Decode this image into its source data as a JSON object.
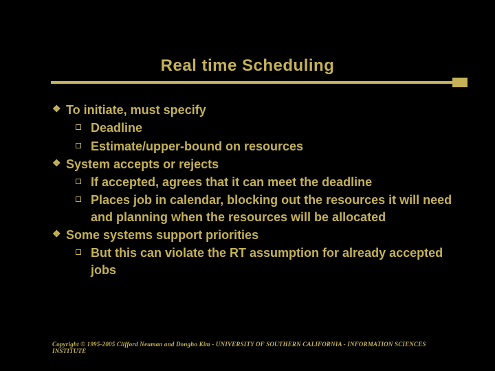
{
  "title": "Real time Scheduling",
  "bullets": {
    "b1": "To initiate, must specify",
    "b1a": "Deadline",
    "b1b": "Estimate/upper-bound on resources",
    "b2": "System accepts or rejects",
    "b2a": "If accepted, agrees that it can meet the deadline",
    "b2b": "Places job in calendar, blocking out the resources it will need and planning when the resources will be allocated",
    "b3": "Some systems support priorities",
    "b3a": "But this can violate the RT assumption for already accepted jobs"
  },
  "footer": "Copyright © 1995-2005 Clifford Neuman and Dongho Kim - UNIVERSITY OF SOUTHERN CALIFORNIA - INFORMATION SCIENCES INSTITUTE"
}
